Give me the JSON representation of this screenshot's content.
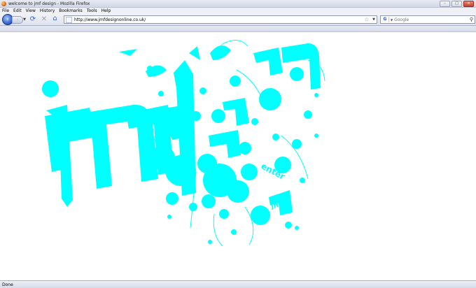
{
  "window": {
    "title": "welcome to jmf design - Mozilla Firefox",
    "controls": {
      "minimize": "–",
      "maximize": "□",
      "close": "✕"
    }
  },
  "menu": [
    "File",
    "Edit",
    "View",
    "History",
    "Bookmarks",
    "Tools",
    "Help"
  ],
  "toolbar": {
    "url": "http://www.jmfdesignonline.co.uk/",
    "search_placeholder": "Google",
    "search_engine_icon": "G"
  },
  "icons": {
    "back": "back-arrow-icon",
    "forward": "forward-arrow-icon",
    "reload": "reload-icon",
    "stop": "stop-icon",
    "home": "home-icon",
    "star": "star-icon",
    "search": "magnifier-icon"
  },
  "page": {
    "logo_text": "jmf",
    "small_logo_texts": [
      "jmf",
      "jmf",
      "jm",
      "jmf",
      "jmf"
    ],
    "enter_text": "enter",
    "accent_color": "#00ffff"
  },
  "status": {
    "text": "Done"
  }
}
